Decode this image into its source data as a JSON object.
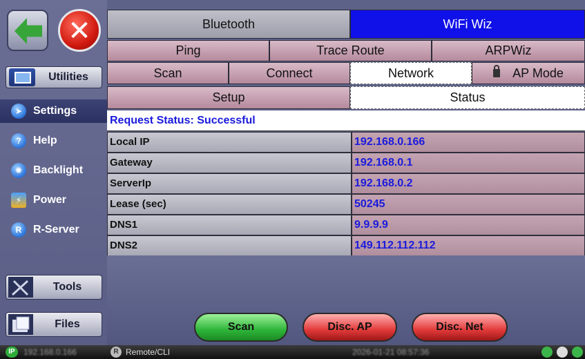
{
  "sidebar": {
    "section_label": "Utilities",
    "items": [
      {
        "label": "Settings",
        "icon": "settings-icon"
      },
      {
        "label": "Help",
        "icon": "help-icon"
      },
      {
        "label": "Backlight",
        "icon": "backlight-icon"
      },
      {
        "label": "Power",
        "icon": "power-icon"
      },
      {
        "label": "R-Server",
        "icon": "r-server-icon"
      }
    ],
    "help_glyph": "?",
    "rserver_glyph": "R",
    "tools_label": "Tools",
    "files_label": "Files"
  },
  "tabs": {
    "row1": [
      "Bluetooth",
      "WiFi Wiz"
    ],
    "row2": [
      "Ping",
      "Trace Route",
      "ARPWiz"
    ],
    "row3": [
      "Scan",
      "Connect",
      "Network",
      "AP Mode"
    ],
    "row4": [
      "Setup",
      "Status"
    ]
  },
  "status": {
    "request": "Request Status: Successful",
    "rows": [
      {
        "key": "Local IP",
        "value": "192.168.0.166"
      },
      {
        "key": "Gateway",
        "value": "192.168.0.1"
      },
      {
        "key": "ServerIp",
        "value": "192.168.0.2"
      },
      {
        "key": "Lease (sec)",
        "value": "50245"
      },
      {
        "key": "DNS1",
        "value": "9.9.9.9"
      },
      {
        "key": "DNS2",
        "value": "149.112.112.112"
      }
    ]
  },
  "buttons": {
    "scan": "Scan",
    "disc_ap": "Disc. AP",
    "disc_net": "Disc. Net"
  },
  "statusbar": {
    "ip_badge": "IP",
    "ip": "192.168.0.166",
    "r_badge": "R",
    "remote": "Remote/CLI",
    "datetime": "2026-01-21 08:57:36"
  },
  "colors": {
    "selected_tab": "#1010e8",
    "value_text": "#1a1adc"
  }
}
